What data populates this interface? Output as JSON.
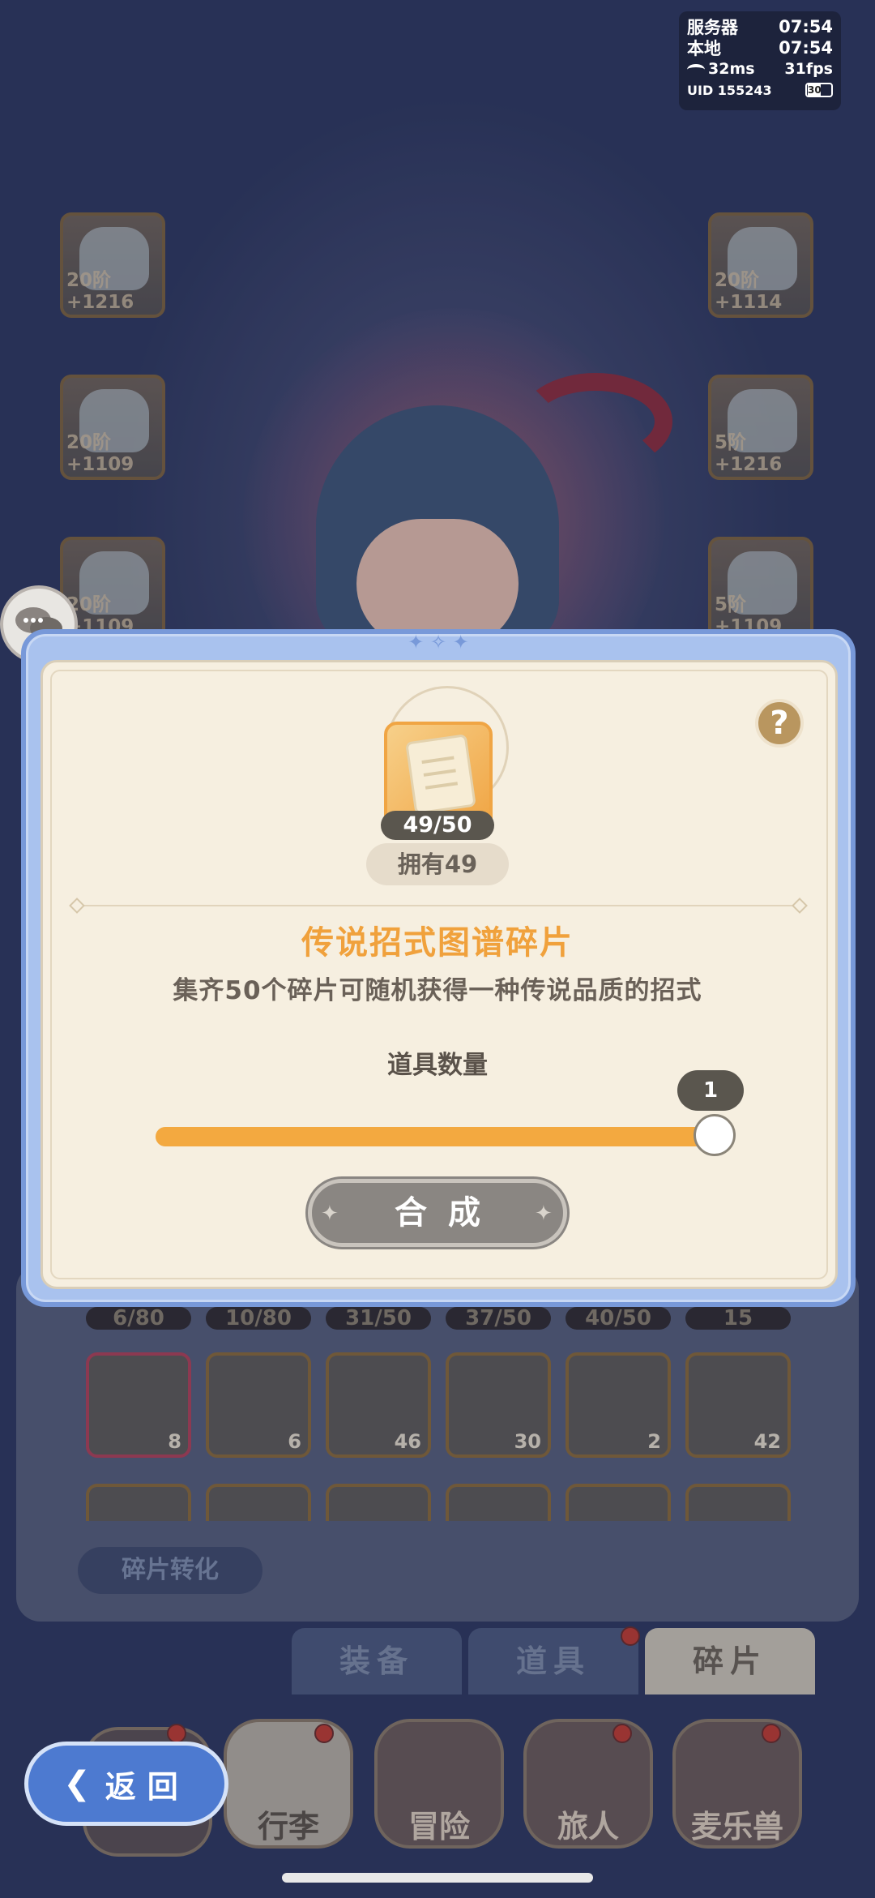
{
  "status": {
    "server_label": "服务器",
    "server_time": "07:54",
    "local_label": "本地",
    "local_time": "07:54",
    "ping": "32ms",
    "fps": "31fps",
    "uid": "UID 155243",
    "battery": "30"
  },
  "equipment_slots": [
    {
      "level": "20阶+1216"
    },
    {
      "level": "20阶+1109"
    },
    {
      "level": "20阶+1109"
    },
    {
      "level": "20阶+1114"
    },
    {
      "level": "5阶+1216"
    },
    {
      "level": "5阶+1109"
    }
  ],
  "dialog": {
    "item_count": "49/50",
    "owned": "拥有49",
    "title": "传说招式图谱碎片",
    "description": "集齐50个碎片可随机获得一种传说品质的招式",
    "quantity_label": "道具数量",
    "quantity_value": "1",
    "slider_fraction": 1.0,
    "help": "?",
    "confirm": "合成"
  },
  "inventory": {
    "progress": [
      "6/80",
      "10/80",
      "31/50",
      "37/50",
      "40/50",
      "15"
    ],
    "counts": [
      "8",
      "6",
      "46",
      "30",
      "2",
      "42"
    ],
    "convert": "碎片转化"
  },
  "tabs": [
    {
      "label": "装备",
      "active": false
    },
    {
      "label": "道具",
      "active": false
    },
    {
      "label": "碎片",
      "active": true
    }
  ],
  "nav": [
    {
      "label": "行李",
      "active": true
    },
    {
      "label": "冒险",
      "active": false
    },
    {
      "label": "旅人",
      "active": false
    },
    {
      "label": "麦乐兽",
      "active": false
    }
  ],
  "back": "返回",
  "colors": {
    "accent": "#f0a13c",
    "dialog_border": "#7899d9",
    "slider": "#f3a940"
  }
}
